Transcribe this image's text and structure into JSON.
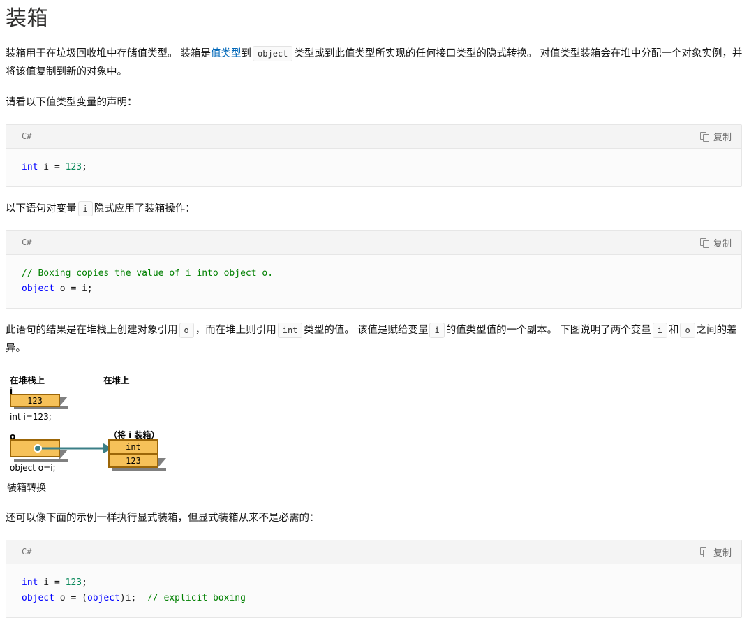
{
  "page": {
    "title": "装箱"
  },
  "intro": {
    "seg1": "装箱用于在垃圾回收堆中存储值类型。 装箱是",
    "link_value_type": "值类型",
    "seg2": "到",
    "code_object": "object",
    "seg3": "类型或到此值类型所实现的任何接口类型的隐式转换。 对值类型装箱会在堆中分配一个对象实例，并将该值复制到新的对象中。"
  },
  "para_declaration": "请看以下值类型变量的声明：",
  "code_block_1": {
    "language": "C#",
    "copy_label": "复制",
    "copy_icon": "copy-icon",
    "lines": [
      {
        "kw": "int",
        "rest": " i = ",
        "num": "123",
        "tail": ";"
      }
    ],
    "code_text": "int i = 123;"
  },
  "para_implicit": {
    "seg1": "以下语句对变量",
    "code_i": "i",
    "seg2": "隐式应用了装箱操作："
  },
  "code_block_2": {
    "language": "C#",
    "copy_label": "复制",
    "copy_icon": "copy-icon",
    "comment_line": "// Boxing copies the value of i into object o.",
    "kw": "object",
    "rest": " o = i;",
    "code_text": "// Boxing copies the value of i into object o.\nobject o = i;"
  },
  "para_result": {
    "seg1": "此语句的结果是在堆栈上创建对象引用",
    "code_o": "o",
    "seg2": "，而在堆上则引用",
    "code_int": "int",
    "seg3": "类型的值。 该值是赋给变量",
    "code_i": "i",
    "seg4": "的值类型值的一个副本。 下图说明了两个变量",
    "code_i2": "i",
    "seg5": "和",
    "code_o2": "o",
    "seg6": "之间的差异。"
  },
  "diagram": {
    "heading_stack": "在堆栈上",
    "heading_heap": "在堆上",
    "var_i": "i",
    "box_i_value": "123",
    "caption_i": "int i=123;",
    "var_o": "o",
    "caption_o": "object o=i;",
    "boxed_label": "（将 i 装箱）",
    "boxed_type": "int",
    "boxed_value": "123",
    "figure_title": "装箱转换",
    "colors": {
      "box_fill": "#f6c159",
      "box_border": "#9c6608",
      "shadow": "#808080",
      "arrow": "#3b7f87"
    }
  },
  "para_explicit": "还可以像下面的示例一样执行显式装箱，但显式装箱从来不是必需的：",
  "code_block_3": {
    "language": "C#",
    "copy_label": "复制",
    "copy_icon": "copy-icon",
    "line1_kw": "int",
    "line1_rest": " i = ",
    "line1_num": "123",
    "line1_tail": ";",
    "line2_kw": "object",
    "line2_mid": " o = (",
    "line2_kw2": "object",
    "line2_mid2": ")i;  ",
    "line2_cmt": "// explicit boxing",
    "code_text": "int i = 123;\nobject o = (object)i;  // explicit boxing"
  }
}
